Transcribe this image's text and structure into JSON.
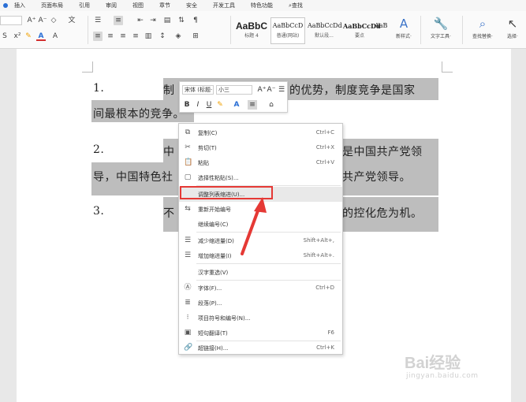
{
  "menu": {
    "items": [
      "插入",
      "页面布局",
      "引用",
      "审阅",
      "视图",
      "章节",
      "安全",
      "开发工具",
      "特色功能"
    ],
    "search_label": "查找"
  },
  "ribbon": {
    "styles": [
      {
        "preview": "AaBbC",
        "caption": "标题 4"
      },
      {
        "preview": "AaBbCcD",
        "caption": "普通(网站)"
      },
      {
        "preview": "AaBbCcDd",
        "caption": "默认段..."
      },
      {
        "preview": "AaBbCcDd",
        "caption": "要点"
      },
      {
        "preview": "AaBbCcDd",
        "caption": ""
      }
    ],
    "new_style_label": "新样式·",
    "text_tools_label": "文字工具·",
    "find_replace_label": "查找替换·",
    "select_label": "选择·"
  },
  "document": {
    "n1": "1.",
    "n2": "2.",
    "n3": "3.",
    "line1a": "制",
    "line1b": "的优势，制度竞争是国家",
    "line1c": "间最根本的竞争。",
    "line2a": "中",
    "line2b": "是中国共产党领",
    "line2c": "导，中国特色社",
    "line2d": "共产党领导。",
    "line3a": "不",
    "line3b": "的控化危为机。"
  },
  "mini_toolbar": {
    "font_name": "宋体 (标题·",
    "font_size": "小三"
  },
  "context_menu": {
    "items": [
      {
        "icon": "copy-icon",
        "label": "复制(C)",
        "shortcut": "Ctrl+C"
      },
      {
        "icon": "cut-icon",
        "label": "剪切(T)",
        "shortcut": "Ctrl+X"
      },
      {
        "icon": "paste-icon",
        "label": "粘贴",
        "shortcut": "Ctrl+V"
      },
      {
        "icon": "paste-special-icon",
        "label": "选择性粘贴(S)...",
        "shortcut": ""
      },
      {
        "icon": "",
        "label": "调整列表缩进(U)...",
        "shortcut": ""
      },
      {
        "icon": "renumber-icon",
        "label": "重新开始编号",
        "shortcut": ""
      },
      {
        "icon": "",
        "label": "继续编号(C)",
        "shortcut": ""
      },
      {
        "icon": "decrease-indent-icon",
        "label": "减少缩进量(D)",
        "shortcut": "Shift+Alt+,"
      },
      {
        "icon": "increase-indent-icon",
        "label": "增加缩进量(I)",
        "shortcut": "Shift+Alt+."
      },
      {
        "icon": "",
        "label": "汉字重选(V)",
        "shortcut": ""
      },
      {
        "icon": "font-icon",
        "label": "字体(F)...",
        "shortcut": "Ctrl+D"
      },
      {
        "icon": "paragraph-icon",
        "label": "段落(P)...",
        "shortcut": ""
      },
      {
        "icon": "bullets-numbering-icon",
        "label": "项目符号和编号(N)...",
        "shortcut": ""
      },
      {
        "icon": "translate-icon",
        "label": "短句翻译(T)",
        "shortcut": "F6"
      },
      {
        "icon": "hyperlink-icon",
        "label": "超链接(H)...",
        "shortcut": "Ctrl+K"
      }
    ]
  },
  "watermark": {
    "line1": "Bai经验",
    "line2": "jingyan.baidu.com"
  },
  "colors": {
    "highlight": "#bdbdbd",
    "annotation_red": "#e53935",
    "accent_blue": "#2a6fd6"
  }
}
